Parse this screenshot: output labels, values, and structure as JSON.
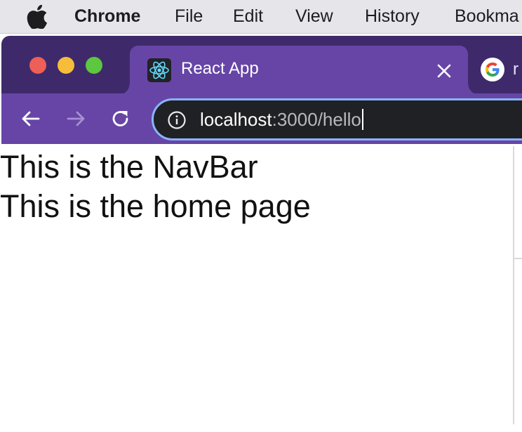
{
  "menubar": {
    "apple_icon": "apple-logo",
    "app_name": "Chrome",
    "items": [
      "File",
      "Edit",
      "View",
      "History",
      "Bookma"
    ]
  },
  "window": {
    "traffic_lights": {
      "close_color": "#ee5f57",
      "minimize_color": "#f6bd3a",
      "zoom_color": "#5cc73f"
    },
    "active_tab": {
      "favicon": "react-icon",
      "title": "React App",
      "close_icon": "close-icon"
    },
    "inactive_tab": {
      "favicon": "google-icon",
      "title": "r"
    },
    "toolbar": {
      "back_icon": "arrow-left-icon",
      "forward_icon": "arrow-right-icon",
      "reload_icon": "reload-icon",
      "site_info_icon": "info-icon",
      "url_host": "localhost",
      "url_rest": ":3000/hello"
    },
    "theme": {
      "tabstrip_color": "#3e2a6b",
      "toolbar_color": "#6745a6",
      "omnibox_focus_color": "#8ab4f8"
    }
  },
  "page": {
    "lines": [
      "This is the NavBar",
      "This is the home page"
    ]
  }
}
